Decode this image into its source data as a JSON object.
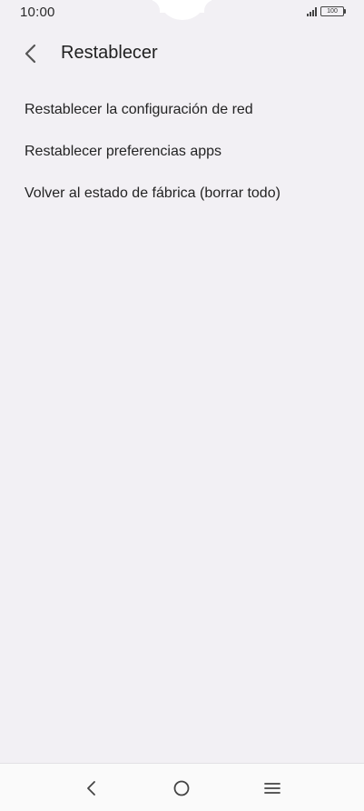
{
  "status_bar": {
    "time": "10:00",
    "battery": "100"
  },
  "header": {
    "title": "Restablecer",
    "back_icon": "chevron-left-icon"
  },
  "menu": {
    "items": [
      {
        "label": "Restablecer la configuración de red"
      },
      {
        "label": "Restablecer preferencias apps"
      },
      {
        "label": "Volver al estado de fábrica (borrar todo)"
      }
    ]
  },
  "navigation_bar": {
    "icons": [
      "nav-back-icon",
      "nav-home-icon",
      "nav-menu-icon"
    ]
  },
  "colors": {
    "background": "#f2f0f4",
    "nav_background": "#fafafa",
    "text": "#1f1f1f"
  }
}
